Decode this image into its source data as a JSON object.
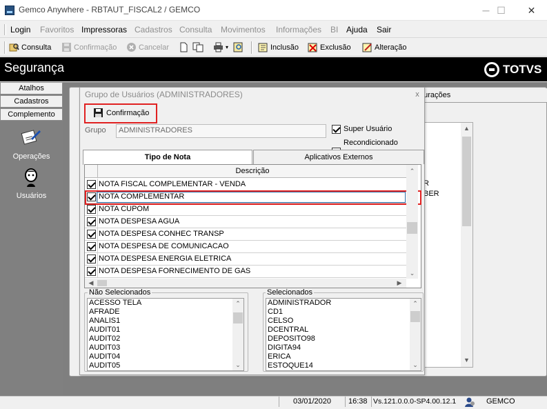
{
  "window": {
    "title": "Gemco Anywhere - RBTAUT_FISCAL2 / GEMCO",
    "minimize": "─",
    "maximize": "☐",
    "close": "✕"
  },
  "menu": {
    "items": [
      {
        "label": "Login",
        "enabled": true
      },
      {
        "label": "Favoritos",
        "enabled": false
      },
      {
        "label": "Impressoras",
        "enabled": true
      },
      {
        "label": "Cadastros",
        "enabled": false
      },
      {
        "label": "Consulta",
        "enabled": false
      },
      {
        "label": "Movimentos",
        "enabled": false
      },
      {
        "label": "Informações",
        "enabled": false
      },
      {
        "label": "BI",
        "enabled": false
      },
      {
        "label": "Ajuda",
        "enabled": true
      },
      {
        "label": "Sair",
        "enabled": true
      }
    ]
  },
  "toolbar": {
    "consulta": "Consulta",
    "confirmacao": "Confirmação",
    "cancelar": "Cancelar",
    "inclusao": "Inclusão",
    "exclusao": "Exclusão",
    "alteracao": "Alteração"
  },
  "header": {
    "title": "Segurança",
    "logo_text": "TOTVS"
  },
  "sidebar": {
    "tabs": [
      "Atalhos",
      "Cadastros",
      "Complemento"
    ],
    "items": [
      {
        "label": "Operações",
        "icon": "operations-icon"
      },
      {
        "label": "Usuários",
        "icon": "users-icon"
      }
    ]
  },
  "background_window": {
    "tab_label": "gurações",
    "list_fragments": [
      "R",
      "BER"
    ]
  },
  "dialog": {
    "title": "Grupo de Usuários  (ADMINISTRADORES)",
    "close": "x",
    "confirm_label": "Confirmação",
    "grupo_label": "Grupo",
    "grupo_value": "ADMINISTRADORES",
    "super_usuario_label": "Super Usuário",
    "super_usuario_checked": true,
    "recondicionado_label": "Recondicionado",
    "recondicionado_checked": false,
    "tabs": [
      "Tipo de Nota",
      "Aplicativos Externos"
    ],
    "grid_header": "Descrição",
    "rows": [
      {
        "label": "NOTA  FISCAL COMPLEMENTAR - VENDA",
        "checked": true
      },
      {
        "label": "NOTA COMPLEMENTAR",
        "checked": true
      },
      {
        "label": "NOTA CUPOM",
        "checked": true
      },
      {
        "label": "NOTA DESPESA AGUA",
        "checked": true
      },
      {
        "label": "NOTA DESPESA CONHEC TRANSP",
        "checked": true
      },
      {
        "label": "NOTA DESPESA DE COMUNICACAO",
        "checked": true
      },
      {
        "label": "NOTA DESPESA ENERGIA ELETRICA",
        "checked": true
      },
      {
        "label": "NOTA DESPESA FORNECIMENTO DE GAS",
        "checked": true
      }
    ],
    "nao_selecionados_label": "Não Selecionados",
    "nao_selecionados": [
      "ACESSO TELA",
      "AFRADE",
      "ANALIS1",
      "AUDIT01",
      "AUDIT02",
      "AUDIT03",
      "AUDIT04",
      "AUDIT05"
    ],
    "selecionados_label": "Selecionados",
    "selecionados": [
      "ADMINISTRADOR",
      "CD1",
      "CELSO",
      "DCENTRAL",
      "DEPOSITO98",
      "DIGITA94",
      "ERICA",
      "ESTOQUE14"
    ]
  },
  "status": {
    "date": "03/01/2020",
    "time": "16:38",
    "version": "Vs.121.0.0.0-SP4.00.12.1",
    "company": "GEMCO"
  },
  "colors": {
    "highlight_border": "#e02020",
    "header_bg": "#000000",
    "sidebar_bg": "#808080"
  }
}
